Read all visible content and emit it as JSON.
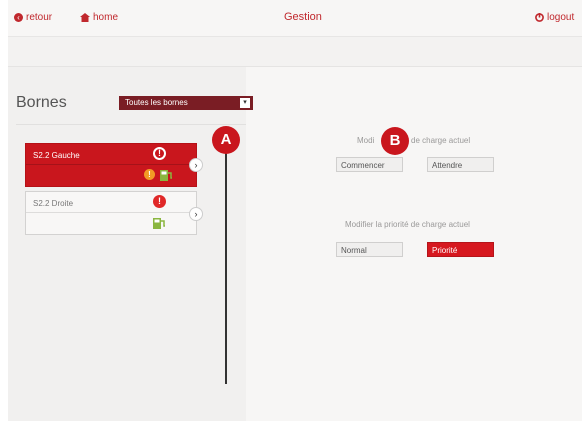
{
  "topbar": {
    "back_label": "retour",
    "home_label": "home",
    "title": "Gestion",
    "logout_label": "logout"
  },
  "bornes": {
    "title": "Bornes",
    "filter_selected": "Toutes les bornes"
  },
  "cards": [
    {
      "label": "S2.2 Gauche",
      "state": "selected"
    },
    {
      "label": "S2.2 Droite",
      "state": "normal"
    }
  ],
  "markers": {
    "a": "A",
    "b": "B"
  },
  "charge_control": {
    "label_left": "Modi",
    "label_right": "de charge actuel",
    "start_label": "Commencer",
    "wait_label": "Attendre"
  },
  "priority_control": {
    "label": "Modifier la priorité de charge actuel",
    "normal_label": "Normal",
    "priority_label": "Priorité"
  },
  "colors": {
    "accent_red": "#c9161d",
    "dark_red": "#7a1d24",
    "orange": "#f29b25",
    "green": "#8ab63f"
  }
}
